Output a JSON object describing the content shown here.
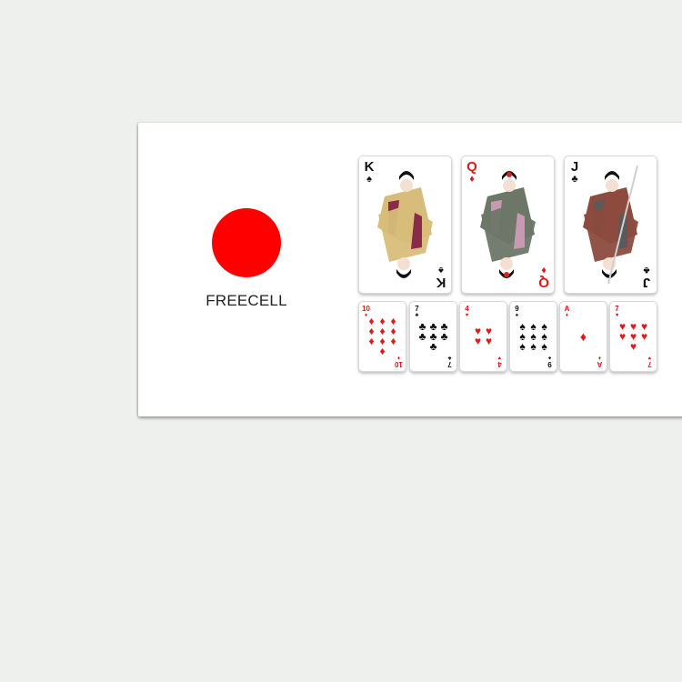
{
  "brand": {
    "logo_text": "FREECELL",
    "dot_color": "#ff0000"
  },
  "face_cards": [
    {
      "rank": "K",
      "suit": "♠",
      "color": "black",
      "robe": "#d8bd7a",
      "accent": "#8b2b4a"
    },
    {
      "rank": "Q",
      "suit": "♦",
      "color": "red",
      "robe": "#6d7768",
      "accent": "#c79ab2"
    },
    {
      "rank": "J",
      "suit": "♣",
      "color": "black",
      "robe": "#8c4b3e",
      "accent": "#5a5a5a"
    }
  ],
  "pip_cards": [
    {
      "rank": "10",
      "suit": "♦",
      "color": "red",
      "count": 10
    },
    {
      "rank": "7",
      "suit": "♣",
      "color": "black",
      "count": 7
    },
    {
      "rank": "4",
      "suit": "♥",
      "color": "red",
      "count": 4
    },
    {
      "rank": "9",
      "suit": "♠",
      "color": "black",
      "count": 9
    },
    {
      "rank": "A",
      "suit": "♦",
      "color": "red",
      "count": 1
    },
    {
      "rank": "7",
      "suit": "♥",
      "color": "red",
      "count": 7
    }
  ]
}
